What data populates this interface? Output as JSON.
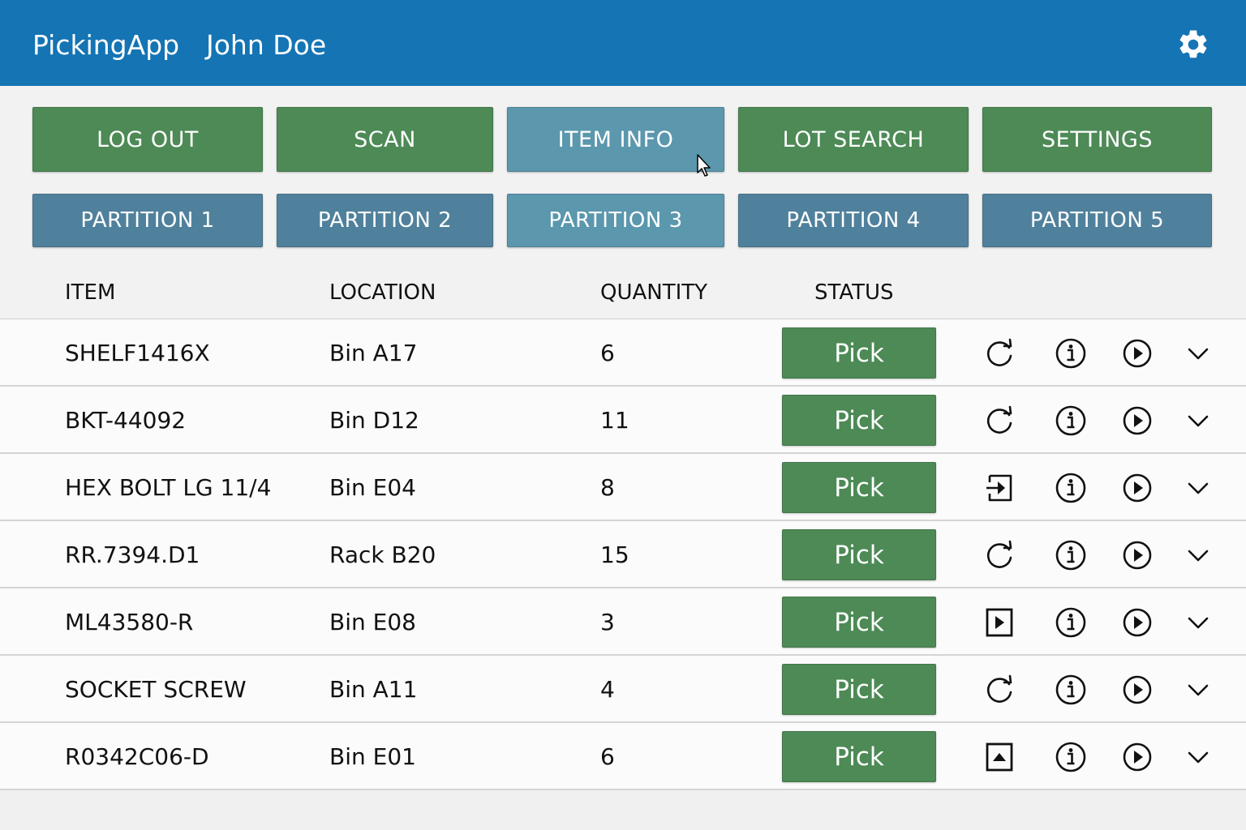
{
  "header": {
    "app_name": "PickingApp",
    "user_name": "John Doe"
  },
  "toolbar": [
    {
      "label": "LOG OUT",
      "style": "green"
    },
    {
      "label": "SCAN",
      "style": "green"
    },
    {
      "label": "ITEM INFO",
      "style": "teal"
    },
    {
      "label": "LOT SEARCH",
      "style": "green"
    },
    {
      "label": "SETTINGS",
      "style": "green"
    }
  ],
  "partitions": [
    {
      "label": "PARTITION 1",
      "active": false
    },
    {
      "label": "PARTITION 2",
      "active": false
    },
    {
      "label": "PARTITION 3",
      "active": true
    },
    {
      "label": "PARTITION 4",
      "active": false
    },
    {
      "label": "PARTITION 5",
      "active": false
    }
  ],
  "table": {
    "columns": [
      "ITEM",
      "LOCATION",
      "QUANTITY",
      "STATUS"
    ],
    "rows": [
      {
        "item": "SHELF1416X",
        "location": "Bin A17",
        "quantity": "6",
        "status": "Pick",
        "action_icon": "refresh-icon"
      },
      {
        "item": "BKT-44092",
        "location": "Bin D12",
        "quantity": "11",
        "status": "Pick",
        "action_icon": "refresh-icon"
      },
      {
        "item": "HEX BOLT LG 11/4",
        "location": "Bin E04",
        "quantity": "8",
        "status": "Pick",
        "action_icon": "move-in-icon"
      },
      {
        "item": "RR.7394.D1",
        "location": "Rack B20",
        "quantity": "15",
        "status": "Pick",
        "action_icon": "refresh-icon"
      },
      {
        "item": "ML43580-R",
        "location": "Bin E08",
        "quantity": "3",
        "status": "Pick",
        "action_icon": "play-square-icon"
      },
      {
        "item": "SOCKET SCREW",
        "location": "Bin A11",
        "quantity": "4",
        "status": "Pick",
        "action_icon": "refresh-icon"
      },
      {
        "item": "R0342C06-D",
        "location": "Bin E01",
        "quantity": "6",
        "status": "Pick",
        "action_icon": "up-square-icon"
      }
    ]
  },
  "colors": {
    "header": "#1474b4",
    "green": "#4d8a56",
    "teal": "#5b97ad",
    "partition": "#50819c"
  }
}
